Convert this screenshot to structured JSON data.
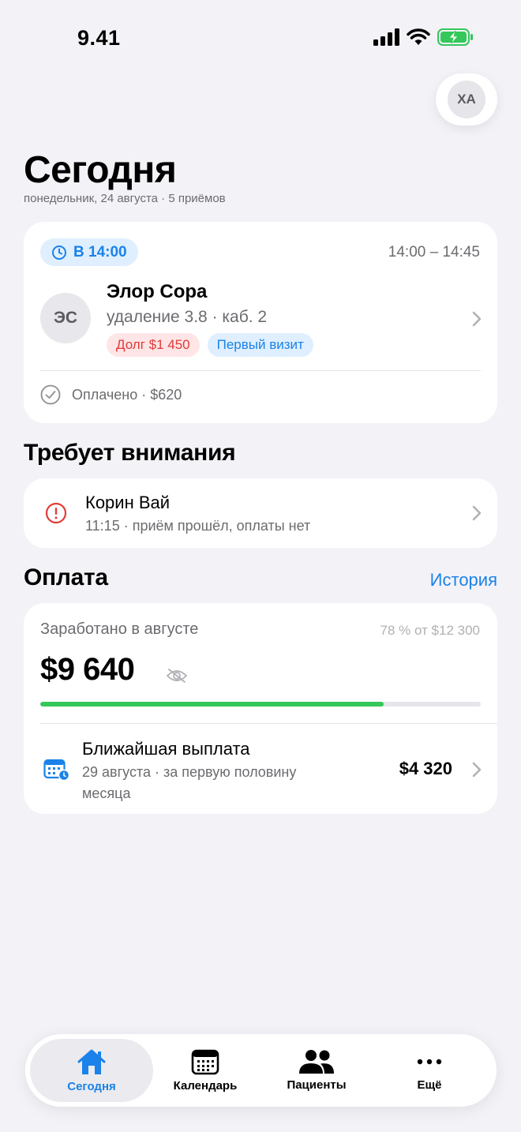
{
  "status": {
    "time": "9.41"
  },
  "profile": {
    "initials": "ХА"
  },
  "header": {
    "title": "Сегодня",
    "subtitle": "понедельник, 24 августа · 5 приёмов"
  },
  "next_appointment": {
    "badge": "В 14:00",
    "time_range": "14:00 – 14:45",
    "initials": "ЭС",
    "name": "Элор Сора",
    "procedure": "удаление 3.8 · каб. 2",
    "tags": {
      "debt": "Долг $1 450",
      "first_visit": "Первый визит"
    },
    "paid": "Оплачено · $620"
  },
  "attention": {
    "title": "Требует внимания",
    "item": {
      "name": "Корин Вай",
      "description": "11:15 · приём прошёл, оплаты нет"
    }
  },
  "payment": {
    "title": "Оплата",
    "history_link": "История",
    "earned_label": "Заработано в августе",
    "earned_pct": "78 % от $12 300",
    "earned_amount": "$9 640",
    "progress_fraction": 0.78,
    "payout": {
      "title": "Ближайшая выплата",
      "description": "29 августа · за первую половину месяца",
      "amount": "$4 320"
    }
  },
  "tabs": [
    {
      "label": "Сегодня",
      "icon": "home-icon",
      "active": true
    },
    {
      "label": "Календарь",
      "icon": "calendar-icon",
      "active": false
    },
    {
      "label": "Пациенты",
      "icon": "people-icon",
      "active": false
    },
    {
      "label": "Ещё",
      "icon": "more-icon",
      "active": false
    }
  ],
  "colors": {
    "accent": "#1a82e8",
    "success": "#34c759",
    "danger": "#e03a3a",
    "background": "#f2f2f7"
  }
}
